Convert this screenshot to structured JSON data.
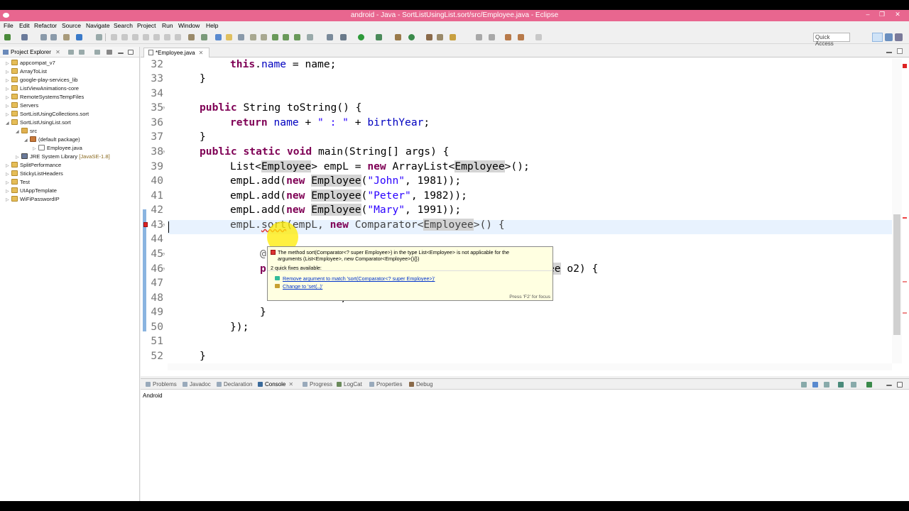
{
  "window": {
    "title": "android - Java - SortListUsingList.sort/src/Employee.java - Eclipse",
    "controls": [
      "–",
      "❐",
      "✕"
    ]
  },
  "menu": [
    "File",
    "Edit",
    "Refactor",
    "Source",
    "Navigate",
    "Search",
    "Project",
    "Run",
    "Window",
    "Help"
  ],
  "quick_access": "Quick Access",
  "project_explorer": {
    "title": "Project Explorer",
    "items": [
      {
        "label": "appcompat_v7",
        "extra": ""
      },
      {
        "label": "ArrayToList",
        "extra": ""
      },
      {
        "label": "google-play-services_lib",
        "extra": ""
      },
      {
        "label": "ListViewAnimations-core",
        "extra": ""
      },
      {
        "label": "RemoteSystemsTempFiles",
        "extra": ""
      },
      {
        "label": "Servers",
        "extra": ""
      },
      {
        "label": "SortListUsingCollections.sort",
        "extra": ""
      },
      {
        "label": "SortListUsingList.sort",
        "extra": ""
      },
      {
        "label": "src",
        "extra": ""
      },
      {
        "label": "(default package)",
        "extra": ""
      },
      {
        "label": "Employee.java",
        "extra": ""
      },
      {
        "label": "JRE System Library",
        "extra": "[JavaSE-1.8]"
      },
      {
        "label": "SplitPerformance",
        "extra": ""
      },
      {
        "label": "StickyListHeaders",
        "extra": ""
      },
      {
        "label": "Test",
        "extra": ""
      },
      {
        "label": "UIAppTemplate",
        "extra": ""
      },
      {
        "label": "WiFiPasswordIP",
        "extra": ""
      }
    ]
  },
  "editor": {
    "tab_label": "*Employee.java",
    "line_numbers": [
      "32",
      "33",
      "34",
      "35",
      "36",
      "37",
      "38",
      "39",
      "40",
      "41",
      "42",
      "43",
      "44",
      "45",
      "46",
      "47",
      "48",
      "49",
      "50",
      "51",
      "52"
    ],
    "lines": {
      "l32a": "this",
      "l32b": ".",
      "l32c": "name",
      "l32d": " = name;",
      "l33": "}",
      "l35a": "public",
      "l35b": " String toString() {",
      "l36a": "return",
      "l36b": " ",
      "l36c": "name",
      "l36d": " + ",
      "l36e": "\" : \"",
      "l36f": " + ",
      "l36g": "birthYear",
      "l36h": ";",
      "l37": "}",
      "l38a": "public static void",
      "l38b": " main(String[] args) {",
      "l39a": "List<",
      "l39b": "Employee",
      "l39c": "> empL = ",
      "l39d": "new",
      "l39e": " ArrayList<",
      "l39f": "Employee",
      "l39g": ">();",
      "l40a": "empL.add(",
      "l40b": "new",
      "l40c": " ",
      "l40d": "Employee",
      "l40e": "(",
      "l40f": "\"John\"",
      "l40g": ", 1981));",
      "l41a": "empL.add(",
      "l41b": "new",
      "l41c": " ",
      "l41d": "Employee",
      "l41e": "(",
      "l41f": "\"Peter\"",
      "l41g": ", 1982));",
      "l42a": "empL.add(",
      "l42b": "new",
      "l42c": " ",
      "l42d": "Employee",
      "l42e": "(",
      "l42f": "\"Mary\"",
      "l42g": ", 1991));",
      "l43a": "empL.",
      "l43b": "sort",
      "l43c": "(empL, ",
      "l43d": "new",
      "l43e": " Comparator<",
      "l43f": "Employee",
      "l43g": ">() {",
      "l45": "@",
      "l46a": "p",
      "l46b": "ee",
      "l46c": " o2) {",
      "l48a": "return",
      "l48b": " 0;",
      "l49": "}",
      "l50": "});",
      "l52": "}"
    }
  },
  "quickfix": {
    "message": "The method sort(Comparator<? super Employee>) in the type List<Employee> is not applicable for the",
    "message2": "arguments (List<Employee>, new Comparator<Employee>(){})",
    "count": "2 quick fixes available:",
    "fix1": "Remove argument to match 'sort(Comparator<? super Employee>)'",
    "fix2": "Change to 'set(..)'",
    "footer": "Press 'F2' for focus"
  },
  "bottom_panel": {
    "tabs": [
      "Problems",
      "Javadoc",
      "Declaration",
      "Console",
      "Progress",
      "LogCat",
      "Properties",
      "Debug"
    ],
    "selected": "Console",
    "console_text": "Android"
  },
  "colors": {
    "title_bar": "#e8668f",
    "keyword": "#7f0055",
    "field": "#0000c0",
    "string": "#2a00ff",
    "highlight": "#ffeb00"
  }
}
